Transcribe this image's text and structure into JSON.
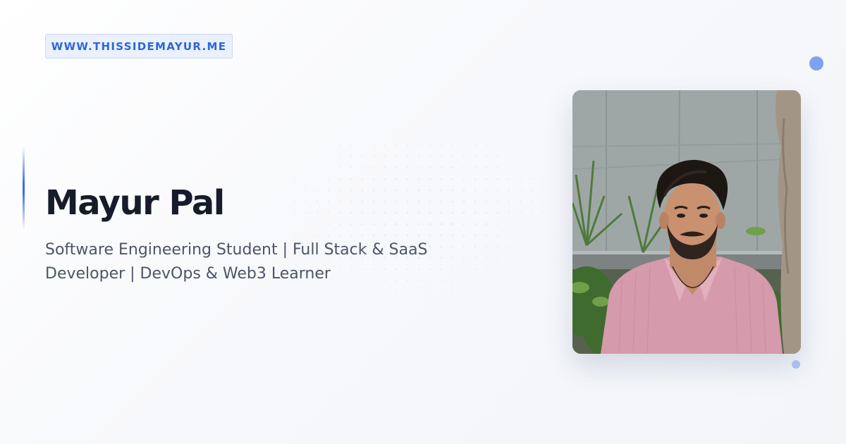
{
  "header": {
    "url_badge": "WWW.THISSIDEMAYUR.ME"
  },
  "profile": {
    "name": "Mayur Pal",
    "tagline_line1": "Software Engineering Student | Full Stack & SaaS",
    "tagline_line2": "Developer | DevOps & Web3 Learner"
  },
  "colors": {
    "accent": "#3b6ce6",
    "badge_text": "#2f66d8",
    "badge_bg": "#eaf0fc",
    "name_text": "#161c2a",
    "tagline_text": "#4c5566"
  }
}
